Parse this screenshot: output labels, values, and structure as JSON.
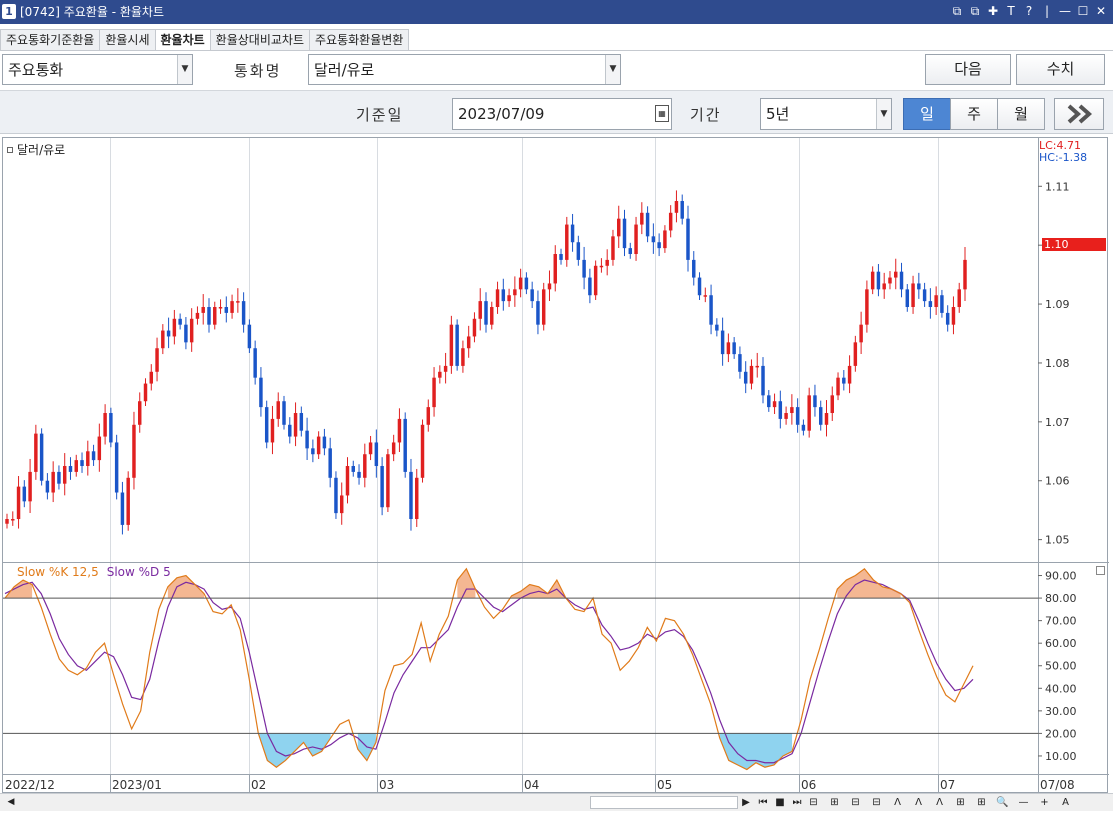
{
  "window": {
    "number": "1",
    "title": "[0742] 주요환율 - 환율차트",
    "controls": [
      "⧉",
      "⧉",
      "✚",
      "T",
      "?",
      "|",
      "—",
      "☐",
      "✕"
    ]
  },
  "tabs": [
    {
      "label": "주요통화기준환율",
      "active": false
    },
    {
      "label": "환율시세",
      "active": false
    },
    {
      "label": "환율차트",
      "active": true
    },
    {
      "label": "환율상대비교차트",
      "active": false
    },
    {
      "label": "주요통화환율변환",
      "active": false
    }
  ],
  "controls": {
    "currency_group": "주요통화",
    "currency_label": "통화명",
    "currency_value": "달러/유로",
    "next_label": "다음",
    "value_label": "수치",
    "date_label": "기준일",
    "date_value": "2023/07/09",
    "period_label": "기간",
    "period_value": "5년",
    "interval": [
      {
        "label": "일",
        "active": true
      },
      {
        "label": "주",
        "active": false
      },
      {
        "label": "월",
        "active": false
      }
    ],
    "forward_icon": "double-chevron-right-icon"
  },
  "chart_data": [
    {
      "type": "candlestick",
      "title": "달러/유로",
      "lc_label": "LC:4.71",
      "hc_label": "HC:-1.38",
      "current_value_label": "1.10",
      "current_value": 1.1,
      "y_ticks": [
        "1.11",
        "1.10",
        "1.09",
        "1.08",
        "1.07",
        "1.06",
        "1.05"
      ],
      "y_tick_values": [
        1.11,
        1.1,
        1.09,
        1.08,
        1.07,
        1.06,
        1.05
      ],
      "ylim": [
        1.0462,
        1.1182
      ],
      "colors": {
        "up": "#e02020",
        "down": "#1a55c8"
      },
      "closes": [
        1.0535,
        1.0535,
        1.059,
        1.0565,
        1.0615,
        1.068,
        1.06,
        1.058,
        1.0615,
        1.0595,
        1.0625,
        1.0615,
        1.0635,
        1.0625,
        1.065,
        1.0635,
        1.0675,
        1.0715,
        1.0665,
        1.058,
        1.0525,
        1.0605,
        1.0695,
        1.0735,
        1.0765,
        1.0785,
        1.0825,
        1.0855,
        1.0845,
        1.0875,
        1.0865,
        1.0835,
        1.0875,
        1.0885,
        1.0895,
        1.0865,
        1.0895,
        1.0895,
        1.0885,
        1.0905,
        1.0905,
        1.0865,
        1.0825,
        1.0775,
        1.0725,
        1.0665,
        1.0705,
        1.0735,
        1.0695,
        1.0675,
        1.0715,
        1.0685,
        1.0655,
        1.0645,
        1.0675,
        1.0655,
        1.0605,
        1.0545,
        1.0575,
        1.0625,
        1.0615,
        1.0605,
        1.0645,
        1.0665,
        1.0625,
        1.0555,
        1.0645,
        1.0665,
        1.0705,
        1.0615,
        1.0535,
        1.0605,
        1.0695,
        1.0725,
        1.0775,
        1.0785,
        1.0795,
        1.0865,
        1.0795,
        1.0825,
        1.0845,
        1.0875,
        1.0905,
        1.0865,
        1.0895,
        1.0925,
        1.0905,
        1.0915,
        1.0925,
        1.0945,
        1.0925,
        1.0905,
        1.0865,
        1.0925,
        1.0935,
        1.0985,
        1.0975,
        1.1035,
        1.1005,
        1.0975,
        1.0945,
        1.0915,
        1.0965,
        1.0965,
        1.0975,
        1.1015,
        1.1045,
        1.0995,
        1.0985,
        1.1035,
        1.1055,
        1.1015,
        1.1005,
        1.0995,
        1.1025,
        1.1055,
        1.1075,
        1.1045,
        1.0975,
        1.0945,
        1.0915,
        1.0915,
        1.0865,
        1.0855,
        1.0815,
        1.0835,
        1.0815,
        1.0785,
        1.0765,
        1.0795,
        1.0795,
        1.0745,
        1.0725,
        1.0735,
        1.0705,
        1.0715,
        1.0725,
        1.0695,
        1.0685,
        1.0745,
        1.0725,
        1.0695,
        1.0715,
        1.0745,
        1.0775,
        1.0765,
        1.0795,
        1.0835,
        1.0865,
        1.0925,
        1.0955,
        1.0925,
        1.0935,
        1.0945,
        1.0955,
        1.0925,
        1.0895,
        1.0935,
        1.0925,
        1.0905,
        1.0895,
        1.0915,
        1.0885,
        1.0865,
        1.0895,
        1.0925,
        1.0975
      ],
      "xlim": [
        0,
        1035
      ],
      "x_ticks": [
        "2022/12",
        "2023/01",
        "02",
        "03",
        "04",
        "05",
        "06",
        "07",
        "07/08"
      ],
      "x_tick_positions": [
        0,
        107,
        246,
        374,
        519,
        652,
        796,
        935,
        1035
      ]
    },
    {
      "type": "line",
      "title": "Slow %K 12,5",
      "series": [
        {
          "name": "Slow %K 12,5",
          "color": "#e07b1a",
          "values": [
            80,
            85,
            88,
            86,
            76,
            64,
            53,
            48,
            46,
            49,
            56,
            60,
            46,
            33,
            22,
            30,
            56,
            75,
            85,
            89,
            90,
            86,
            82,
            74,
            73,
            77,
            66,
            44,
            20,
            8,
            5,
            8,
            12,
            16,
            10,
            12,
            18,
            24,
            26,
            13,
            8,
            16,
            39,
            50,
            51,
            55,
            69,
            52,
            64,
            72,
            88,
            93,
            84,
            76,
            71,
            75,
            81,
            83,
            86,
            85,
            82,
            88,
            80,
            75,
            74,
            80,
            64,
            60,
            48,
            52,
            58,
            67,
            61,
            71,
            70,
            64,
            55,
            44,
            33,
            18,
            8,
            6,
            4,
            7,
            5,
            6,
            10,
            12,
            26,
            44,
            57,
            71,
            84,
            88,
            90,
            93,
            88,
            85,
            84,
            82,
            78,
            66,
            55,
            45,
            37,
            34,
            42,
            50
          ]
        },
        {
          "name": "Slow %D 5",
          "color": "#7a2aa0",
          "values": [
            82,
            84,
            86,
            87,
            82,
            73,
            62,
            55,
            50,
            48,
            52,
            56,
            54,
            46,
            36,
            35,
            44,
            61,
            76,
            85,
            87,
            86,
            84,
            78,
            75,
            76,
            71,
            56,
            38,
            20,
            12,
            10,
            11,
            13,
            14,
            13,
            15,
            18,
            20,
            18,
            14,
            13,
            25,
            38,
            46,
            52,
            58,
            58,
            62,
            66,
            76,
            84,
            84,
            80,
            76,
            74,
            77,
            80,
            82,
            83,
            82,
            84,
            80,
            77,
            75,
            76,
            68,
            63,
            57,
            58,
            60,
            64,
            62,
            65,
            66,
            63,
            57,
            48,
            38,
            26,
            16,
            11,
            8,
            8,
            7,
            7,
            9,
            11,
            20,
            34,
            48,
            61,
            73,
            81,
            86,
            88,
            87,
            86,
            84,
            82,
            79,
            70,
            60,
            51,
            44,
            39,
            40,
            44
          ]
        }
      ],
      "y_ticks": [
        "90.00",
        "80.00",
        "70.00",
        "60.00",
        "50.00",
        "40.00",
        "30.00",
        "20.00",
        "10.00"
      ],
      "y_tick_values": [
        90,
        80,
        70,
        60,
        50,
        40,
        30,
        20,
        10
      ],
      "ylim": [
        2,
        96
      ],
      "upper_band": 80,
      "lower_band": 20,
      "colors": {
        "overbought_fill": "#f4b792",
        "oversold_fill": "#8fd3ef"
      }
    }
  ],
  "toolbar_icons": [
    "▶",
    "⏮",
    "■",
    "⏭",
    "⊟",
    "⊞",
    "⊟",
    "⊟",
    "Λ",
    "Λ",
    "Λ",
    "⊞",
    "⊞",
    "🔍",
    "—",
    "+",
    "A"
  ]
}
